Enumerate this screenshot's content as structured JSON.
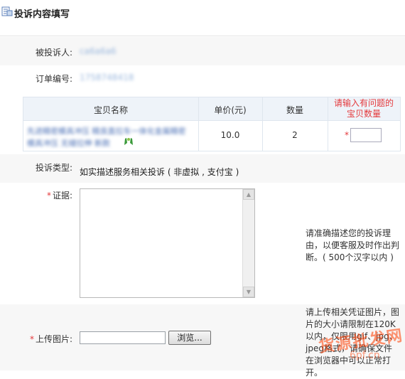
{
  "header": {
    "title": "投诉内容填写",
    "icon": "document-icon"
  },
  "respondent": {
    "label": "被投诉人:",
    "value": "ca6a6a6"
  },
  "order": {
    "label": "订单编号:",
    "value": "1758748418"
  },
  "goods_table": {
    "headers": [
      "宝贝名称",
      "单价(元)",
      "数量",
      "请输入有问题的宝贝数量"
    ],
    "rows": [
      {
        "name": "先进精密模具冲压 精良直拉车一体化金属精密模具冲压 无缝拉伸 新款",
        "unit_price": "10.0",
        "quantity": "2",
        "required_mark": "*",
        "problem_qty": ""
      }
    ]
  },
  "complaint_type": {
    "label": "投诉类型:",
    "value": "如实描述服务相关投诉 ( 非虚拟 , 支付宝 )"
  },
  "evidence": {
    "label": "证据:",
    "required_mark": "*",
    "value": "",
    "hint": "请准确描述您的投诉理由，以便客服及时作出判断。( 500个汉字以内 )"
  },
  "upload": {
    "label": "上传图片:",
    "required_mark": "*",
    "browse_label": "浏览...",
    "hint": "请上传相关凭证图片，图片的大小请限制在120K以内，仅限用gif、jpg、jpeg格式，请确保文件在浏览器中可以正常打开。"
  },
  "watermark": {
    "text": "货源批发网",
    "sub": "6pf.cn"
  }
}
